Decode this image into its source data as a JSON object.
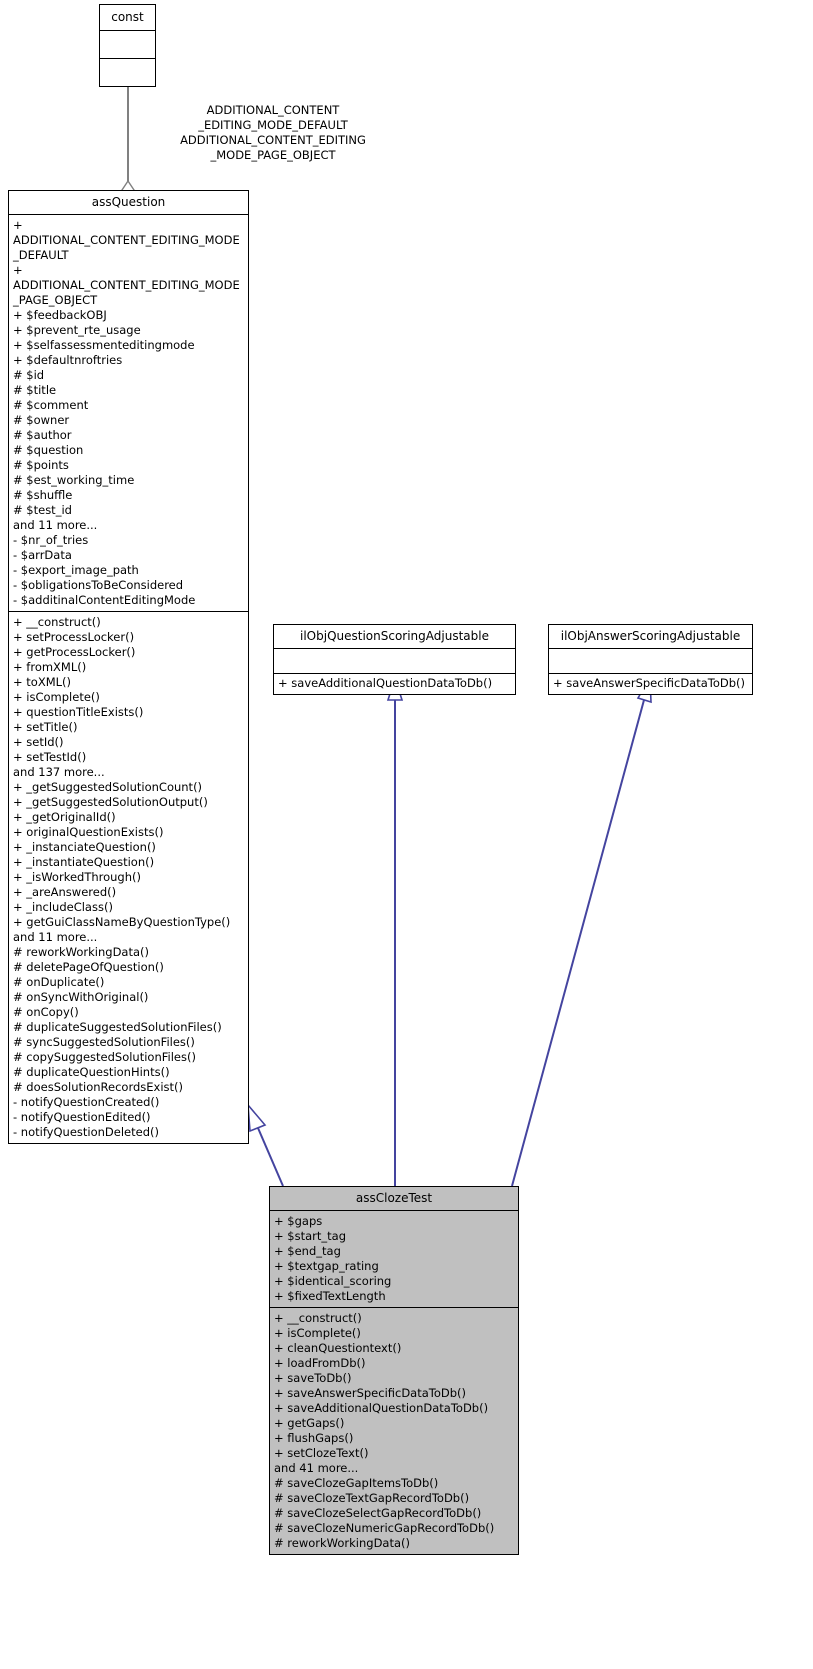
{
  "diagram": {
    "type": "uml-class-diagram",
    "colors": {
      "box_border": "#000000",
      "box_fill": "#ffffff",
      "highlight_fill": "#c0c0c0",
      "inheritance_edge": "#44449f",
      "aggregation_edge": "#808080",
      "text": "#000000"
    }
  },
  "classes": {
    "const": {
      "name": "const",
      "attributes": [],
      "operations": []
    },
    "assQuestion": {
      "name": "assQuestion",
      "attributes": [
        "+ ADDITIONAL_CONTENT_EDITING_MODE_DEFAULT",
        "+ ADDITIONAL_CONTENT_EDITING_MODE_PAGE_OBJECT",
        "+ $feedbackOBJ",
        "+ $prevent_rte_usage",
        "+ $selfassessmenteditingmode",
        "+ $defaultnroftries",
        "# $id",
        "# $title",
        "# $comment",
        "# $owner",
        "# $author",
        "# $question",
        "# $points",
        "# $est_working_time",
        "# $shuffle",
        "# $test_id",
        "and 11 more...",
        "- $nr_of_tries",
        "- $arrData",
        "- $export_image_path",
        "- $obligationsToBeConsidered",
        "- $additinalContentEditingMode"
      ],
      "operations": [
        "+ __construct()",
        "+ setProcessLocker()",
        "+ getProcessLocker()",
        "+ fromXML()",
        "+ toXML()",
        "+ isComplete()",
        "+ questionTitleExists()",
        "+ setTitle()",
        "+ setId()",
        "+ setTestId()",
        "and 137 more...",
        "+ _getSuggestedSolutionCount()",
        "+ _getSuggestedSolutionOutput()",
        "+ _getOriginalId()",
        "+ originalQuestionExists()",
        "+ _instanciateQuestion()",
        "+ _instantiateQuestion()",
        "+ _isWorkedThrough()",
        "+ _areAnswered()",
        "+ _includeClass()",
        "+ getGuiClassNameByQuestionType()",
        "and 11 more...",
        "# reworkWorkingData()",
        "# deletePageOfQuestion()",
        "# onDuplicate()",
        "# onSyncWithOriginal()",
        "# onCopy()",
        "# duplicateSuggestedSolutionFiles()",
        "# syncSuggestedSolutionFiles()",
        "# copySuggestedSolutionFiles()",
        "# duplicateQuestionHints()",
        "# doesSolutionRecordsExist()",
        "- notifyQuestionCreated()",
        "- notifyQuestionEdited()",
        "- notifyQuestionDeleted()"
      ]
    },
    "ilObjQuestionScoringAdjustable": {
      "name": "ilObjQuestionScoringAdjustable",
      "attributes": [],
      "operations": [
        "+ saveAdditionalQuestionDataToDb()"
      ]
    },
    "ilObjAnswerScoringAdjustable": {
      "name": "ilObjAnswerScoringAdjustable",
      "attributes": [],
      "operations": [
        "+ saveAnswerSpecificDataToDb()"
      ]
    },
    "assClozeTest": {
      "name": "assClozeTest",
      "attributes": [
        "+ $gaps",
        "+ $start_tag",
        "+ $end_tag",
        "+ $textgap_rating",
        "+ $identical_scoring",
        "+ $fixedTextLength"
      ],
      "operations": [
        "+ __construct()",
        "+ isComplete()",
        "+ cleanQuestiontext()",
        "+ loadFromDb()",
        "+ saveToDb()",
        "+ saveAnswerSpecificDataToDb()",
        "+ saveAdditionalQuestionDataToDb()",
        "+ getGaps()",
        "+ flushGaps()",
        "+ setClozeText()",
        "and 41 more...",
        "# saveClozeGapItemsToDb()",
        "# saveClozeTextGapRecordToDb()",
        "# saveClozeSelectGapRecordToDb()",
        "# saveClozeNumericGapRecordToDb()",
        "# reworkWorkingData()"
      ]
    }
  },
  "edges": {
    "const_to_assQuestion_label": "ADDITIONAL_CONTENT\n_EDITING_MODE_DEFAULT\nADDITIONAL_CONTENT_EDITING\n_MODE_PAGE_OBJECT"
  }
}
